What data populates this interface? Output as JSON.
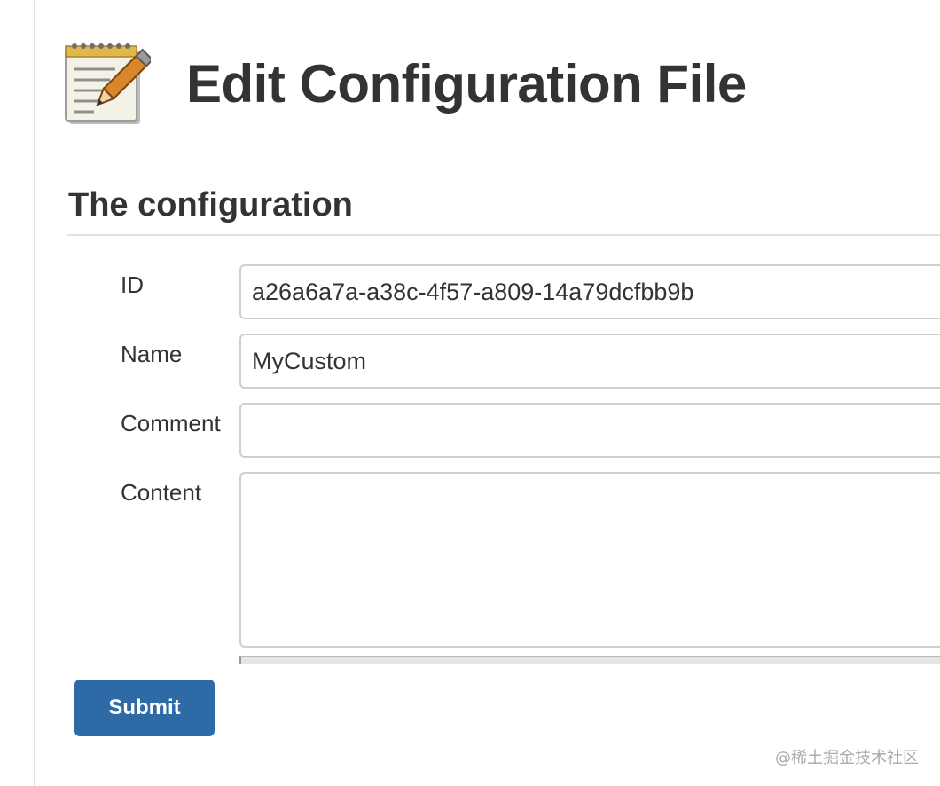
{
  "header": {
    "title": "Edit Configuration File",
    "icon": "notepad-pencil-icon"
  },
  "section": {
    "title": "The configuration"
  },
  "form": {
    "id_label": "ID",
    "id_value": "a26a6a7a-a38c-4f57-a809-14a79dcfbb9b",
    "name_label": "Name",
    "name_value": "MyCustom",
    "comment_label": "Comment",
    "comment_value": "",
    "content_label": "Content",
    "content_value": ""
  },
  "actions": {
    "submit_label": "Submit"
  },
  "watermark": {
    "text": "@稀土掘金技术社区"
  },
  "colors": {
    "submit_bg": "#2e6aa6",
    "text": "#333333",
    "input_border": "#cfcfcf"
  }
}
